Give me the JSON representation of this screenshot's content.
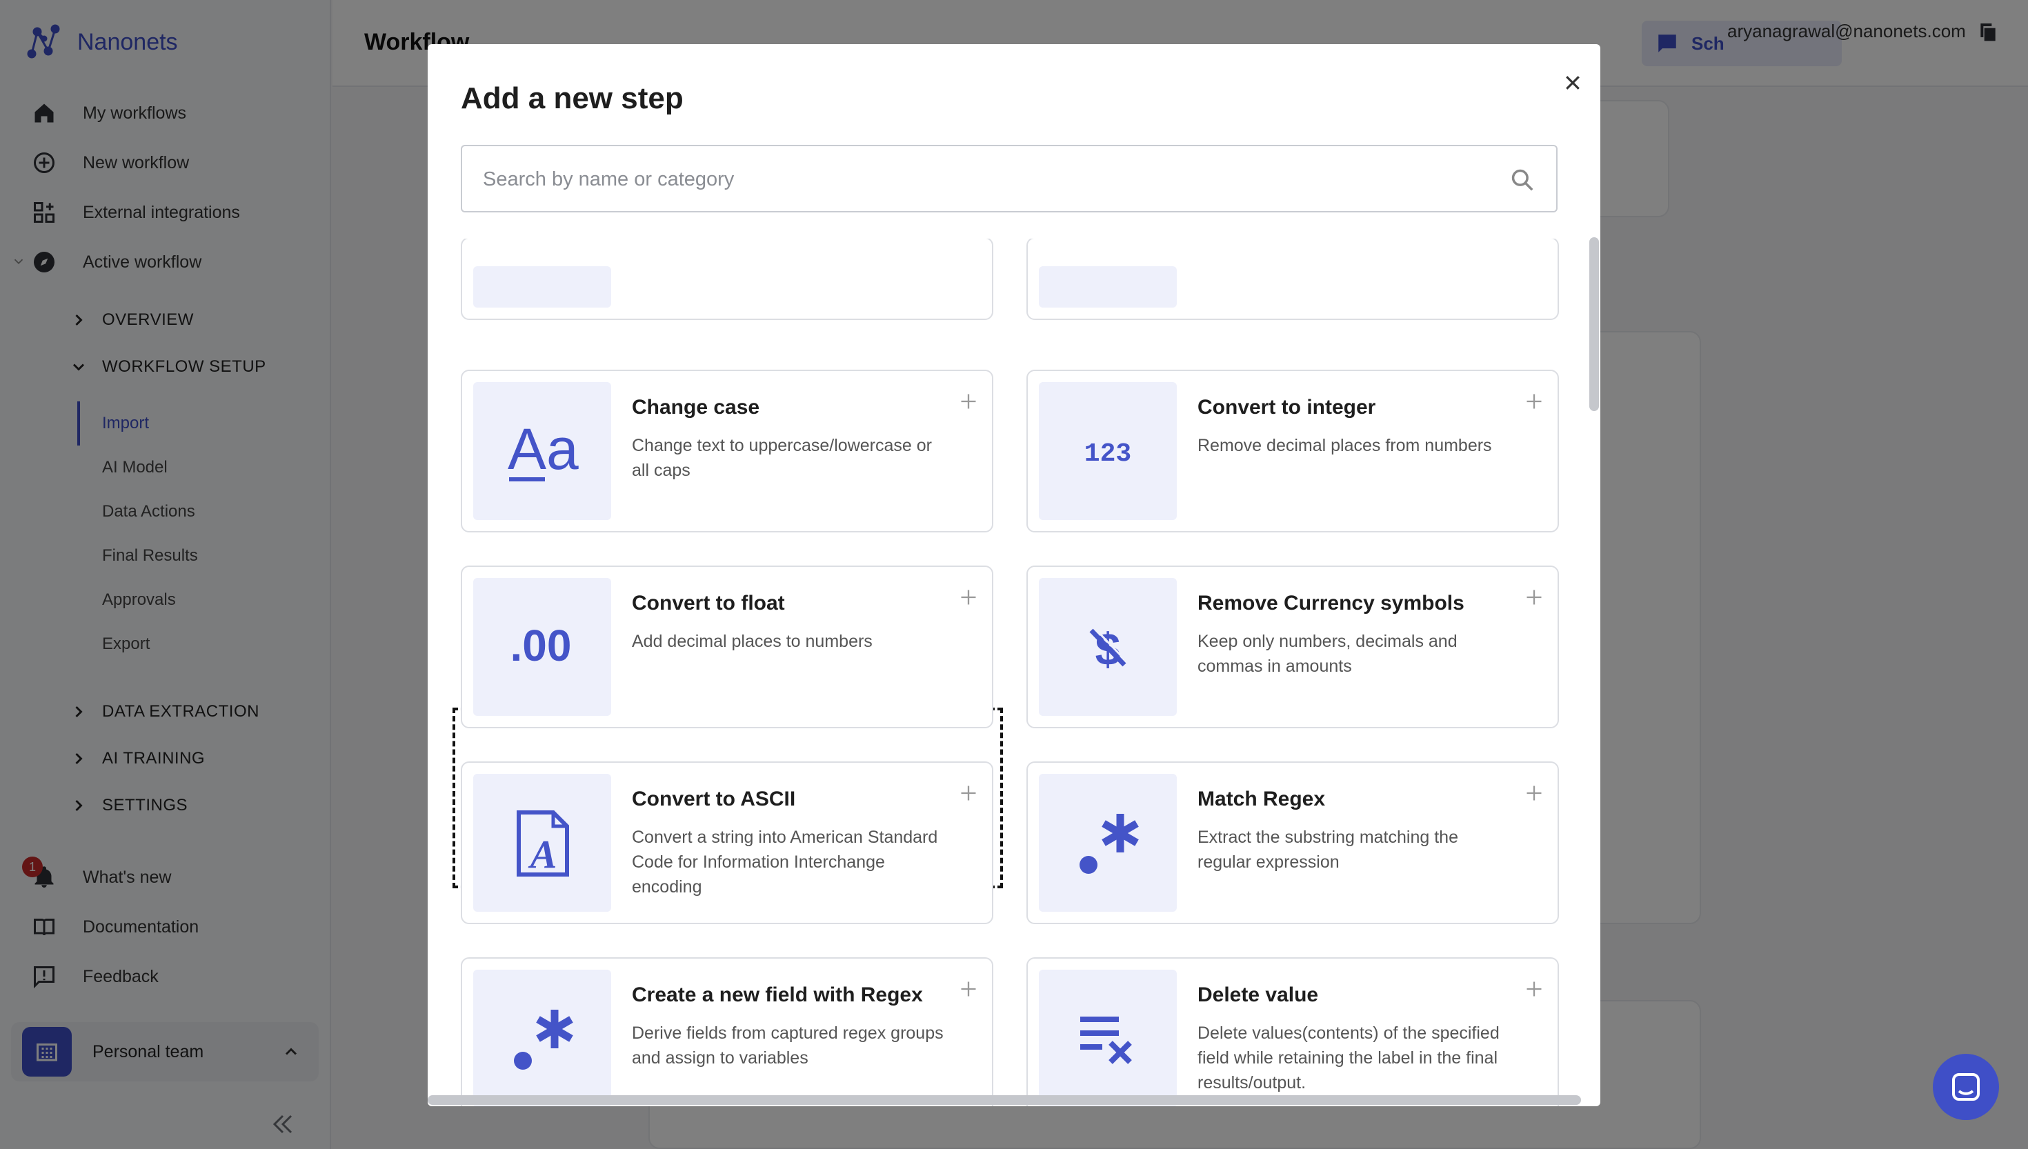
{
  "app": {
    "brand": "Nanonets"
  },
  "nav": {
    "items": [
      {
        "label": "My workflows",
        "icon": "home-icon"
      },
      {
        "label": "New workflow",
        "icon": "plus-circle-icon"
      },
      {
        "label": "External integrations",
        "icon": "grid-icon"
      },
      {
        "label": "Active workflow",
        "icon": "compass-icon"
      }
    ],
    "sections": {
      "overview": "OVERVIEW",
      "workflow_setup": "WORKFLOW SETUP",
      "data_extraction": "DATA EXTRACTION",
      "ai_training": "AI TRAINING",
      "settings": "SETTINGS"
    },
    "setup_items": [
      "Import",
      "AI Model",
      "Data Actions",
      "Final Results",
      "Approvals",
      "Export"
    ],
    "active_setup_item": "Import",
    "footer": [
      {
        "label": "What's new",
        "icon": "bell-icon",
        "badge": "1"
      },
      {
        "label": "Documentation",
        "icon": "book-icon"
      },
      {
        "label": "Feedback",
        "icon": "feedback-icon"
      }
    ],
    "team": "Personal team"
  },
  "header": {
    "title": "Workflow",
    "schedule_label": "Sch",
    "user_email": "aryanagrawal@nanonets.com"
  },
  "modal": {
    "title": "Add a new step",
    "search_placeholder": "Search by name or category",
    "search_value": "",
    "cards": [
      {
        "title": "Change case",
        "desc": "Change text to uppercase/lowercase or all caps",
        "icon": "text-case-icon"
      },
      {
        "title": "Convert to integer",
        "desc": "Remove decimal places from numbers",
        "icon": "integer-icon"
      },
      {
        "title": "Convert to float",
        "desc": "Add decimal places to numbers",
        "icon": "float-icon",
        "highlighted": true
      },
      {
        "title": "Remove Currency symbols",
        "desc": "Keep only numbers, decimals and commas in amounts",
        "icon": "no-currency-icon"
      },
      {
        "title": "Convert to ASCII",
        "desc": "Convert a string into American Standard Code for Information Interchange encoding",
        "icon": "ascii-icon"
      },
      {
        "title": "Match Regex",
        "desc": "Extract the substring matching the regular expression",
        "icon": "regex-icon"
      },
      {
        "title": "Create a new field with Regex",
        "desc": "Derive fields from captured regex groups and assign to variables",
        "icon": "regex-icon"
      },
      {
        "title": "Delete value",
        "desc": "Delete values(contents) of the specified field while retaining the label in the final results/output.",
        "icon": "delete-value-icon"
      }
    ]
  },
  "colors": {
    "accent": "#3f4fc7",
    "tile_bg": "#eef0fb",
    "overlay": "rgba(0,0,0,0.5)",
    "badge": "#c62a2a"
  }
}
